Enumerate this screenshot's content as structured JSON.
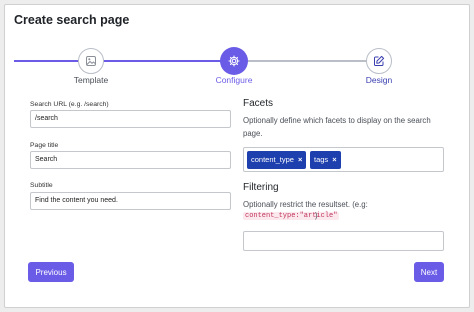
{
  "title": "Create search page",
  "steps": [
    {
      "label": "Template",
      "icon": "image-icon",
      "state": "done"
    },
    {
      "label": "Configure",
      "icon": "gear-icon",
      "state": "active"
    },
    {
      "label": "Design",
      "icon": "edit-icon",
      "state": "upcoming"
    }
  ],
  "form": {
    "search_url": {
      "label": "Search URL (e.g. /search)",
      "value": "/search"
    },
    "page_title": {
      "label": "Page title",
      "value": "Search"
    },
    "subtitle": {
      "label": "Subtitle",
      "value": "Find the content you need."
    }
  },
  "facets": {
    "heading": "Facets",
    "description": "Optionally define which facets to display on the search page.",
    "tags": [
      "content_type",
      "tags"
    ]
  },
  "filtering": {
    "heading": "Filtering",
    "description": "Optionally restrict the resultset. (e.g:",
    "example_code": "content_type:\"article\"",
    "example_close": ")",
    "value": ""
  },
  "buttons": {
    "previous": "Previous",
    "next": "Next"
  },
  "colors": {
    "accent": "#6b5ce7",
    "tag": "#1e40af",
    "code_text": "#c0345c"
  }
}
